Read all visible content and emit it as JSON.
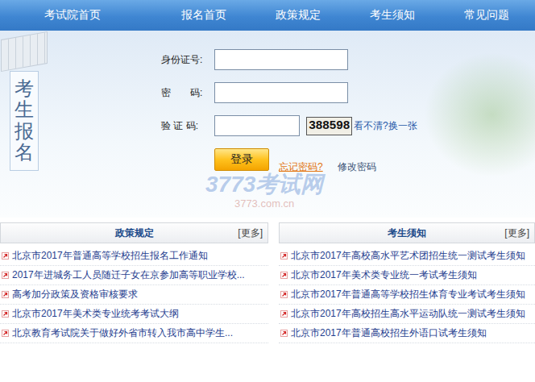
{
  "nav": [
    {
      "label": "考试院首页"
    },
    {
      "label": "报名首页"
    },
    {
      "label": "政策规定"
    },
    {
      "label": "考生须知"
    },
    {
      "label": "常见问题"
    }
  ],
  "side_title": "考生报名",
  "form": {
    "fields": [
      {
        "label": "身份证号:",
        "kind": "text"
      },
      {
        "label": "密　　码:",
        "kind": "password"
      }
    ],
    "captcha": {
      "label": "验 证 码:",
      "code": "388598",
      "refresh": "看不清?换一张"
    },
    "submit": "登录",
    "links": [
      {
        "label": "忘记密码?",
        "kind": "warning"
      },
      {
        "label": "修改密码",
        "kind": "plain"
      }
    ]
  },
  "watermark": {
    "title": "3773考试网",
    "url": "3773.com.cn"
  },
  "panels": [
    {
      "title": "政策规定",
      "more": "[更多]",
      "items": [
        "北京市2017年普通高等学校招生报名工作通知",
        "2017年进城务工人员随迁子女在京参加高等职业学校...",
        "高考加分政策及资格审核要求",
        "北京市2017年美术类专业统考考试大纲",
        "北京教育考试院关于做好外省市转入我市高中学生..."
      ]
    },
    {
      "title": "考生须知",
      "more": "[更多]",
      "items": [
        "北京市2017年高校高水平艺术团招生统一测试考生须知",
        "北京市2017年美术类专业统一考试考生须知",
        "北京市2017年普通高等学校招生体育专业考试考生须知",
        "北京市2017年高校招生高水平运动队统一测试考生须知",
        "北京市2017年普通高校招生外语口试考生须知"
      ]
    }
  ]
}
